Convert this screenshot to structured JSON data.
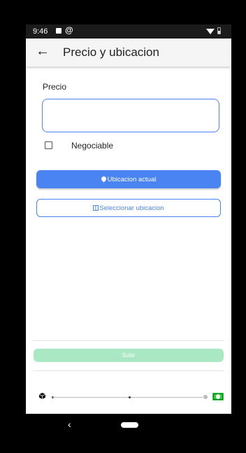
{
  "status_bar": {
    "time": "9:46",
    "icons": [
      "image-icon",
      "at-icon",
      "wifi-icon",
      "battery-icon"
    ]
  },
  "app_bar": {
    "back_icon": "arrow-left-icon",
    "title": "Precio y ubicacion"
  },
  "form": {
    "price_label": "Precio",
    "price_value": "",
    "negotiable_label": "Negociable",
    "negotiable_checked": false
  },
  "buttons": {
    "current_location": "Ubicacion actual",
    "current_location_icon": "map-pin-icon",
    "select_location": "Seleccionar ubicacion",
    "select_location_icon": "map-icon",
    "submit": "Subir"
  },
  "progress": {
    "start_icon": "cube-icon",
    "end_icon": "money-icon",
    "current_step": 2,
    "total_steps": 3
  },
  "colors": {
    "primary": "#4a84f2",
    "submit_disabled": "#a9e8c2",
    "money_green": "#2ecc40"
  },
  "nav_bar": {
    "back_glyph": "‹",
    "icons": [
      "nav-back-icon",
      "home-pill-icon"
    ]
  }
}
